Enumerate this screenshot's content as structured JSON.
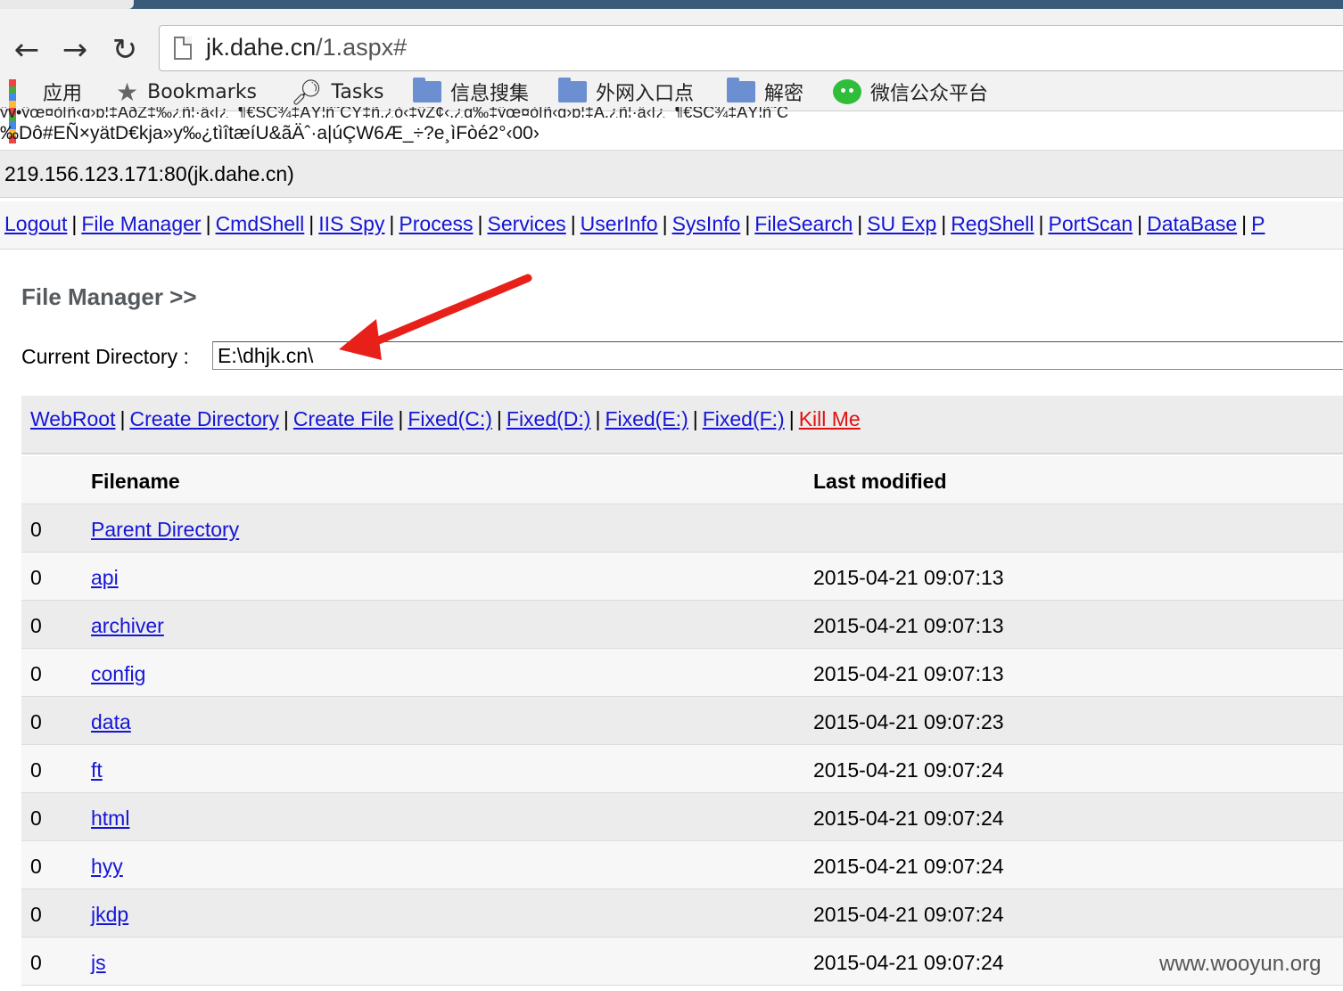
{
  "browser": {
    "url_host": "jk.dahe.cn",
    "url_path": "/1.aspx#",
    "bookmarks": [
      {
        "label": "应用",
        "icon": "apps-icon"
      },
      {
        "label": "Bookmarks",
        "icon": "star-icon"
      },
      {
        "label": "Tasks",
        "icon": "magnifier-icon"
      },
      {
        "label": "信息搜集",
        "icon": "folder-icon"
      },
      {
        "label": "外网入口点",
        "icon": "folder-icon"
      },
      {
        "label": "解密",
        "icon": "folder-icon"
      },
      {
        "label": "微信公众平台",
        "icon": "wechat-icon"
      }
    ]
  },
  "page": {
    "garbled_line_1": "ÿy•ÿœ¤ò[ñ‹g›p¦‡ÁðŽ‡‰¿ñ¦·ä‹[¿_¶€ŠÇ¾‡ÂŸ¦ñ˜ÇŸ‡ñ,¿ò‹‡ÿŽ¢‹,¿g‰‡ÿœ¤ò[ñ‹g›p¦‡Á,¿ñ¦·ä‹[¿_¶€ŠÇ¾‡ÂŸ¦ñ˜Ç",
    "garbled_line_2": "‰Dô#EÑ×yätD€kja»y‰¿tìîtæíU&ãÄˆ·a|úÇW6Æ_÷?e¸ìFòé2°‹00›",
    "host": "219.156.123.171:80(jk.dahe.cn)",
    "menu": [
      "Logout",
      "File Manager",
      "CmdShell",
      "IIS Spy",
      "Process",
      "Services",
      "UserInfo",
      "SysInfo",
      "FileSearch",
      "SU Exp",
      "RegShell",
      "PortScan",
      "DataBase",
      "P"
    ],
    "fm_title": "File Manager >>",
    "current_dir_label": "Current Directory :",
    "current_dir_value": "E:\\dhjk.cn\\",
    "actions": [
      "WebRoot",
      "Create Directory",
      "Create File",
      "Fixed(C:)",
      "Fixed(D:)",
      "Fixed(E:)",
      "Fixed(F:)"
    ],
    "kill_label": "Kill Me",
    "table": {
      "col_filename": "Filename",
      "col_modified": "Last modified",
      "rows": [
        {
          "num": "0",
          "name": "Parent Directory",
          "date": ""
        },
        {
          "num": "0",
          "name": "api",
          "date": "2015-04-21 09:07:13"
        },
        {
          "num": "0",
          "name": "archiver",
          "date": "2015-04-21 09:07:13"
        },
        {
          "num": "0",
          "name": "config",
          "date": "2015-04-21 09:07:13"
        },
        {
          "num": "0",
          "name": "data",
          "date": "2015-04-21 09:07:23"
        },
        {
          "num": "0",
          "name": "ft",
          "date": "2015-04-21 09:07:24"
        },
        {
          "num": "0",
          "name": "html",
          "date": "2015-04-21 09:07:24"
        },
        {
          "num": "0",
          "name": "hyy",
          "date": "2015-04-21 09:07:24"
        },
        {
          "num": "0",
          "name": "jkdp",
          "date": "2015-04-21 09:07:24"
        },
        {
          "num": "0",
          "name": "js",
          "date": "2015-04-21 09:07:24"
        }
      ]
    },
    "watermark": "www.wooyun.org"
  },
  "colors": {
    "link": "#1515d6",
    "kill": "#e01010",
    "arrow": "#e8201a"
  }
}
